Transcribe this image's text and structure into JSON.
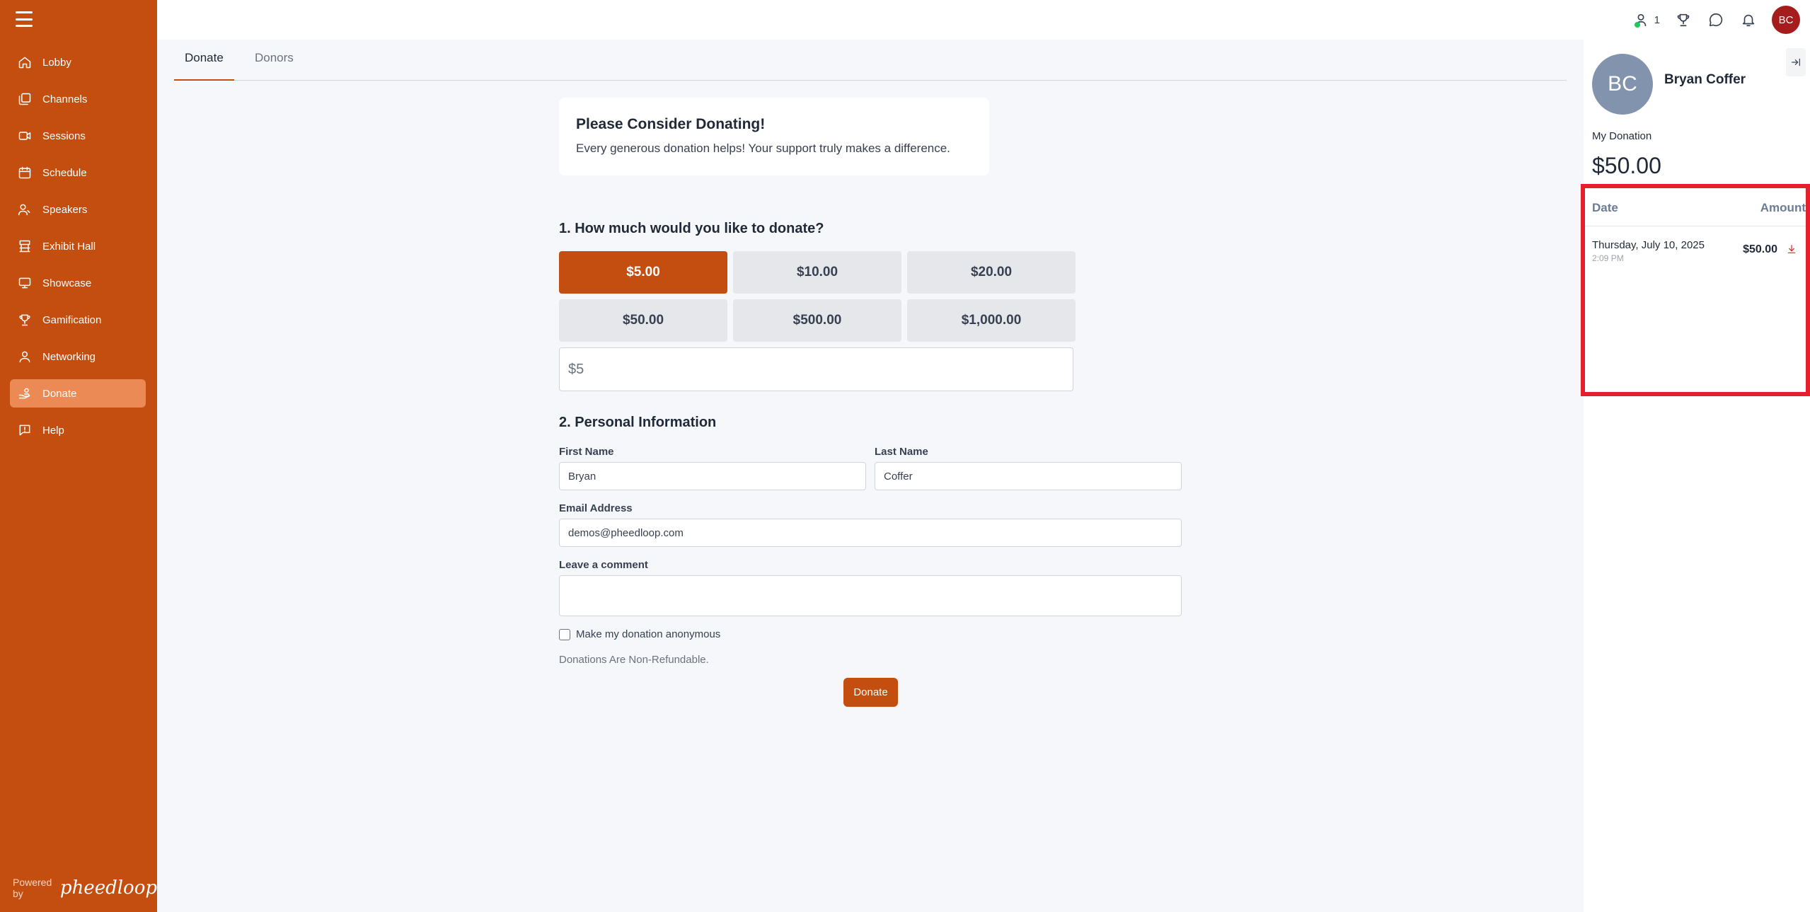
{
  "sidebar": {
    "items": [
      {
        "label": "Lobby",
        "icon": "home-icon"
      },
      {
        "label": "Channels",
        "icon": "channels-icon"
      },
      {
        "label": "Sessions",
        "icon": "video-icon"
      },
      {
        "label": "Schedule",
        "icon": "calendar-icon"
      },
      {
        "label": "Speakers",
        "icon": "speaker-icon"
      },
      {
        "label": "Exhibit Hall",
        "icon": "exhibit-icon"
      },
      {
        "label": "Showcase",
        "icon": "monitor-icon"
      },
      {
        "label": "Gamification",
        "icon": "trophy-icon"
      },
      {
        "label": "Networking",
        "icon": "people-icon"
      },
      {
        "label": "Donate",
        "icon": "donate-icon",
        "active": true
      },
      {
        "label": "Help",
        "icon": "help-icon"
      }
    ],
    "powered_by": "Powered by",
    "brand": "pheedloop"
  },
  "topbar": {
    "online_count": "1",
    "avatar_initials": "BC"
  },
  "tabs": [
    {
      "label": "Donate",
      "active": true
    },
    {
      "label": "Donors",
      "active": false
    }
  ],
  "intro": {
    "title": "Please Consider Donating!",
    "text": "Every generous donation helps! Your support truly makes a difference."
  },
  "form": {
    "section1_title": "1. How much would you like to donate?",
    "amounts": [
      "$5.00",
      "$10.00",
      "$20.00",
      "$50.00",
      "$500.00",
      "$1,000.00"
    ],
    "selected_amount": "$5.00",
    "custom_amount_value": "$5",
    "section2_title": "2. Personal Information",
    "first_name_label": "First Name",
    "first_name_value": "Bryan",
    "last_name_label": "Last Name",
    "last_name_value": "Coffer",
    "email_label": "Email Address",
    "email_value": "demos@pheedloop.com",
    "comment_label": "Leave a comment",
    "comment_value": "",
    "anonymous_label": "Make my donation anonymous",
    "anonymous_checked": false,
    "refund_note": "Donations Are Non-Refundable.",
    "submit_label": "Donate"
  },
  "profile": {
    "initials": "BC",
    "name": "Bryan Coffer",
    "my_donation_label": "My Donation",
    "my_donation_value": "$50.00",
    "history_headers": {
      "date": "Date",
      "amount": "Amount"
    },
    "history": [
      {
        "date": "Thursday, July 10, 2025",
        "time": "2:09 PM",
        "amount": "$50.00"
      }
    ]
  },
  "colors": {
    "brand": "#c44e10",
    "sidebar_active": "#ec8a55",
    "highlight_border": "#e5202e",
    "avatar_small": "#a51c1c",
    "avatar_large": "#8293ad"
  }
}
